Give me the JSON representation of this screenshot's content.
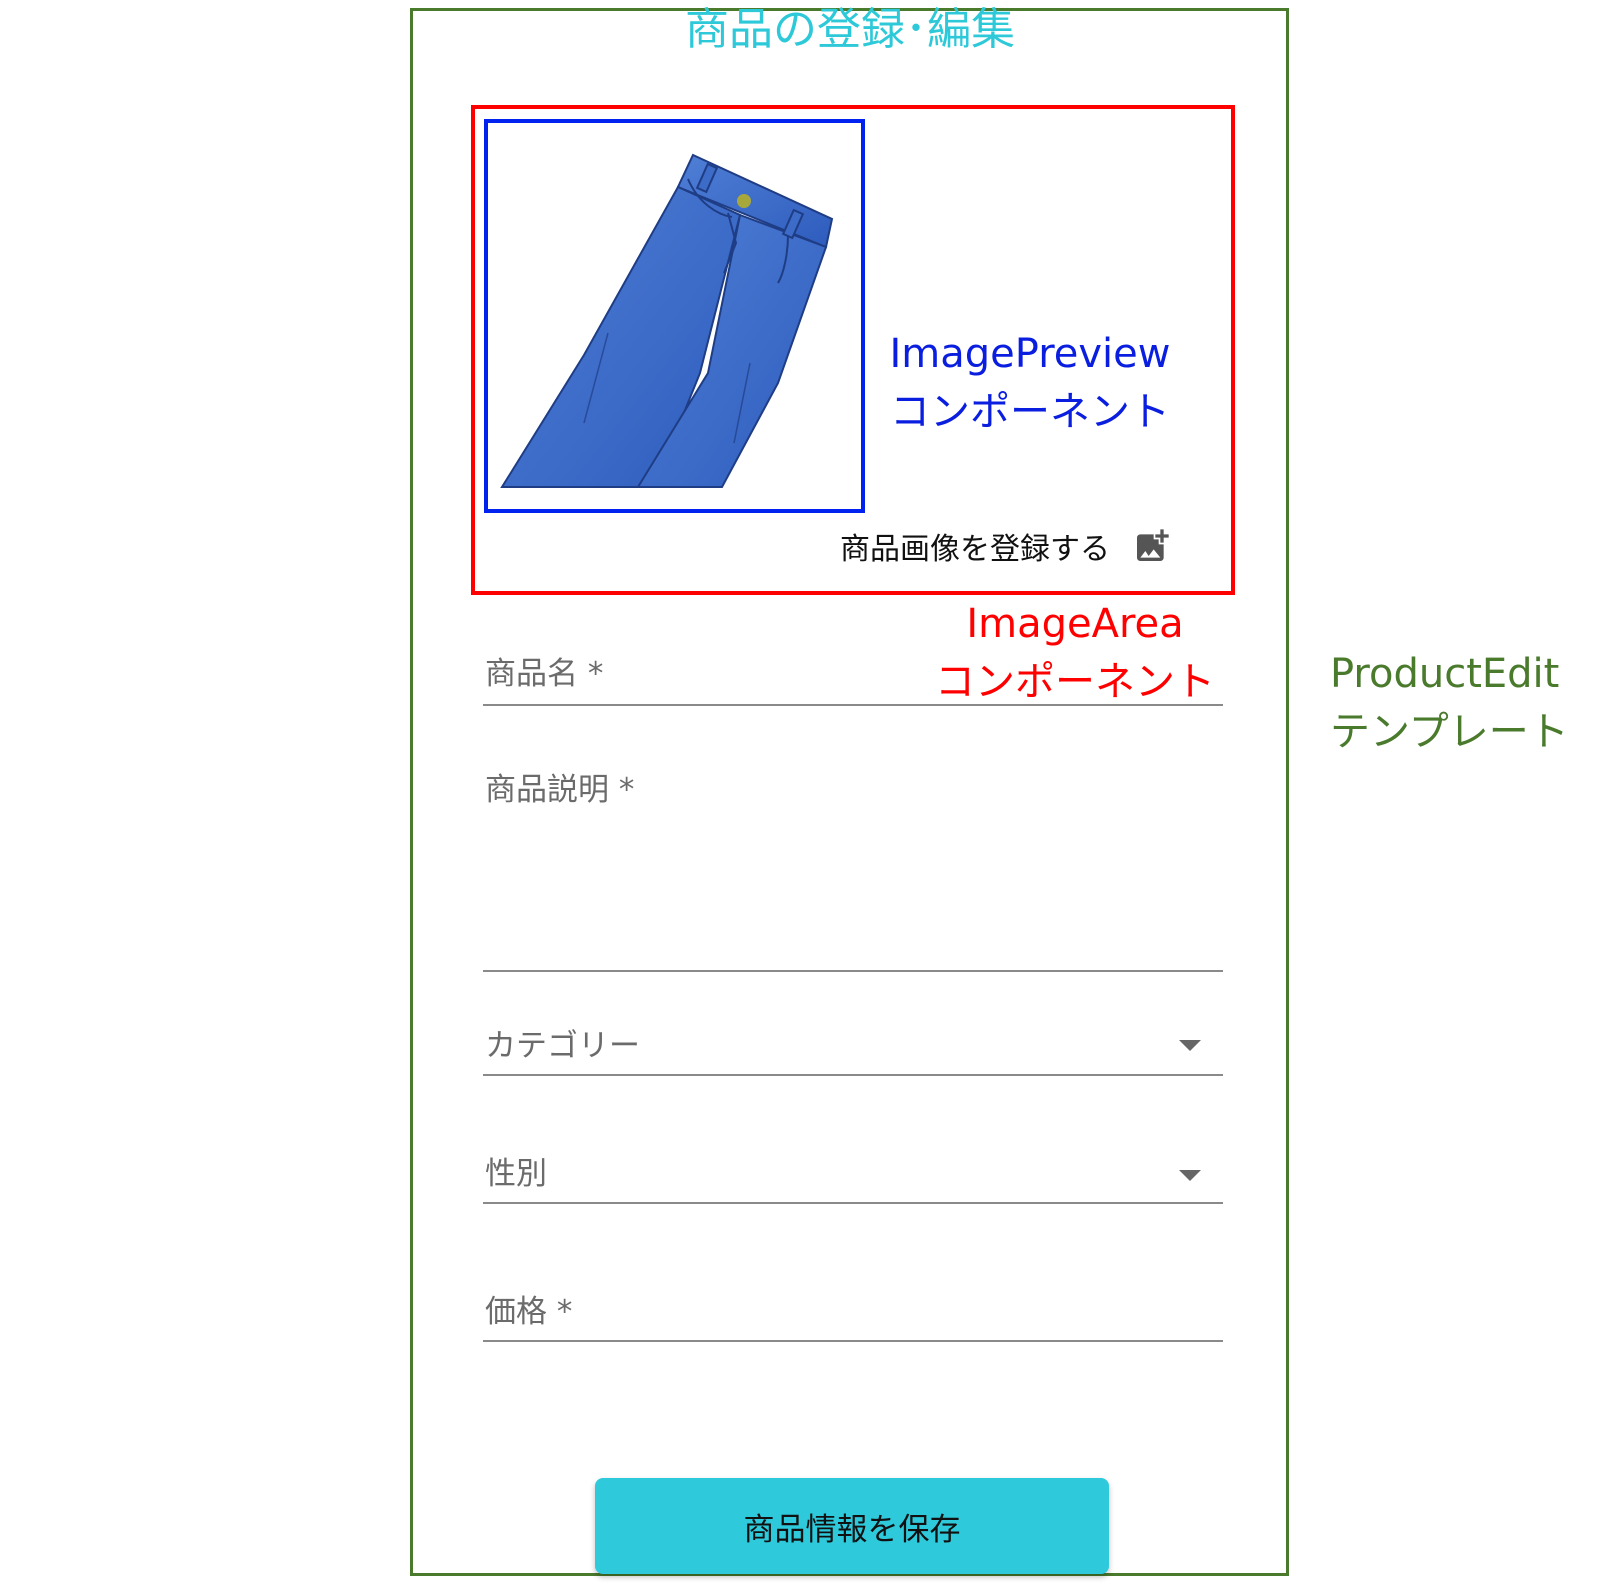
{
  "page_title": "商品の登録･編集",
  "image_area": {
    "upload_label": "商品画像を登録する",
    "upload_icon": "add-photo-icon",
    "preview_image": "jeans-illustration"
  },
  "annotations": {
    "image_preview": [
      "ImagePreview",
      "コンポーネント"
    ],
    "image_area": [
      "ImageArea",
      "コンポーネント"
    ],
    "product_edit": [
      "ProductEdit",
      "テンプレート"
    ]
  },
  "form": {
    "name_label": "商品名 *",
    "description_label": "商品説明 *",
    "category_label": "カテゴリー",
    "gender_label": "性別",
    "price_label": "価格 *"
  },
  "save_button_label": "商品情報を保存",
  "colors": {
    "accent": "#2ecadc",
    "template_border": "#4a7a2c",
    "image_area_border": "#ff0000",
    "image_preview_border": "#0022ee",
    "jeans_blue": "#3a68c4"
  }
}
